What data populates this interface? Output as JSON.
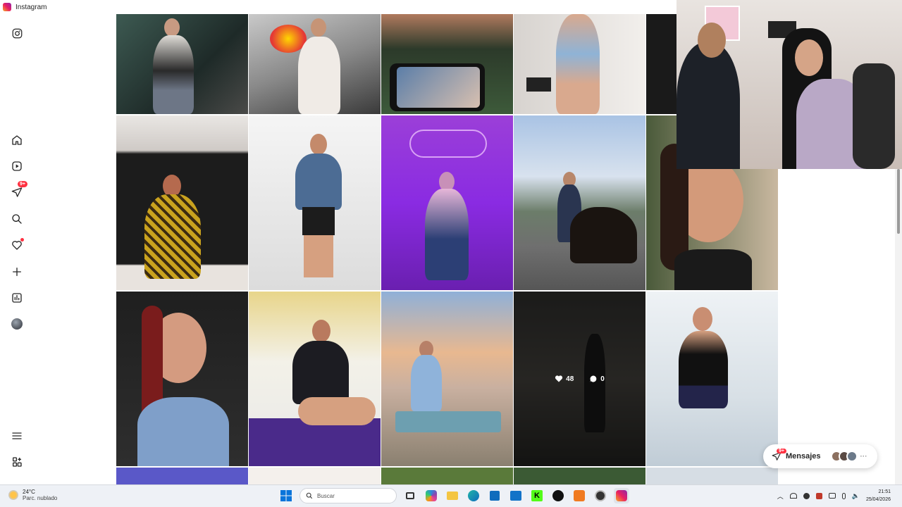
{
  "window": {
    "title": "Instagram"
  },
  "sidebar": {
    "items": [
      {
        "name": "instagram-logo-icon"
      },
      {
        "name": "home-icon"
      },
      {
        "name": "reels-icon"
      },
      {
        "name": "messages-icon",
        "badge": "9+"
      },
      {
        "name": "search-icon"
      },
      {
        "name": "notifications-icon"
      },
      {
        "name": "create-icon"
      },
      {
        "name": "dashboard-icon"
      },
      {
        "name": "profile-avatar-icon"
      },
      {
        "name": "more-menu-icon"
      },
      {
        "name": "also-from-meta-icon"
      }
    ]
  },
  "grid": {
    "hover_post": {
      "likes": "48",
      "comments": "0"
    }
  },
  "messages_pill": {
    "label": "Mensajes",
    "badge": "9+"
  },
  "taskbar": {
    "weather_temp": "24°C",
    "weather_desc": "Parc. nublado",
    "search_placeholder": "Buscar",
    "time": "21:51",
    "date": "25/04/2026"
  },
  "colors": {
    "accent": "#ff3040",
    "purple": "#8a2be2"
  }
}
